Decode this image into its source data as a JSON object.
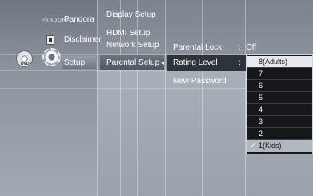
{
  "left_menu": {
    "pandora_logo": "PANDORA",
    "pandora": "Pandora",
    "disclaimer": "Disclaimer",
    "dvd_badge": "DVD",
    "setup": "Setup"
  },
  "setup_menu": {
    "items": [
      "Display Setup",
      "HDMI Setup",
      "Network Setup",
      "Parental Setup"
    ],
    "arrow": "◂"
  },
  "parental_menu": {
    "parental_lock_label": "Parental Lock",
    "parental_lock_sep": ":",
    "parental_lock_value": "Off",
    "rating_level_label": "Rating Level",
    "rating_level_sep": ":",
    "new_password_label": "New Password"
  },
  "rating_dropdown": {
    "options": [
      "8(Adults)",
      "7",
      "6",
      "5",
      "4",
      "3",
      "2",
      "1(Kids)"
    ],
    "highlighted": "8(Adults)",
    "checked": "1(Kids)",
    "check_glyph": "✓"
  }
}
